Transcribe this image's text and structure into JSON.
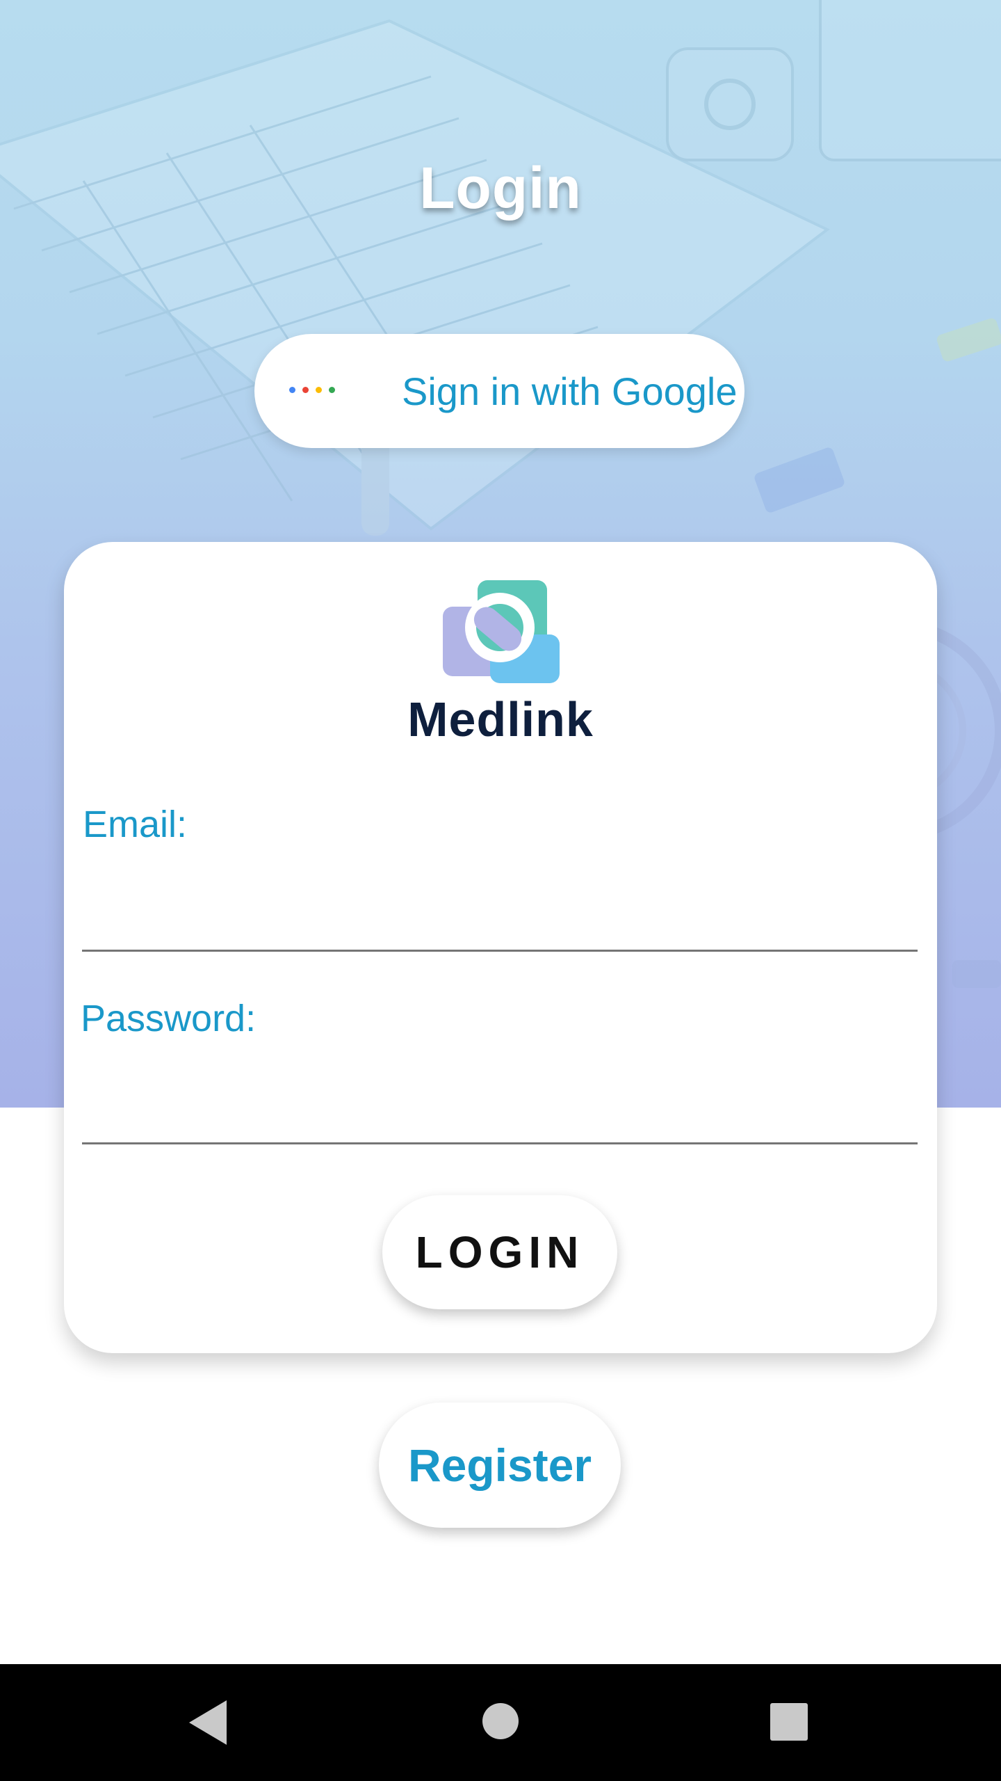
{
  "header": {
    "title": "Login"
  },
  "google_signin": {
    "label": "Sign in with Google",
    "dot_colors": [
      "#4285F4",
      "#EA4335",
      "#FBBC05",
      "#34A853"
    ]
  },
  "card": {
    "brand_name": "Medlink",
    "email": {
      "label": "Email:",
      "value": "",
      "placeholder": ""
    },
    "password": {
      "label": "Password:",
      "value": "",
      "placeholder": ""
    },
    "login_label": "LOGIN"
  },
  "register_label": "Register",
  "colors": {
    "accent": "#1a98c9",
    "brand_dark": "#0e1f3d",
    "logo_teal": "#5cc7b8",
    "logo_lavender": "#b1b4e6",
    "logo_sky": "#6cc3ef"
  },
  "navbar": {
    "back": "back-triangle-icon",
    "home": "home-circle-icon",
    "recents": "recents-square-icon"
  }
}
